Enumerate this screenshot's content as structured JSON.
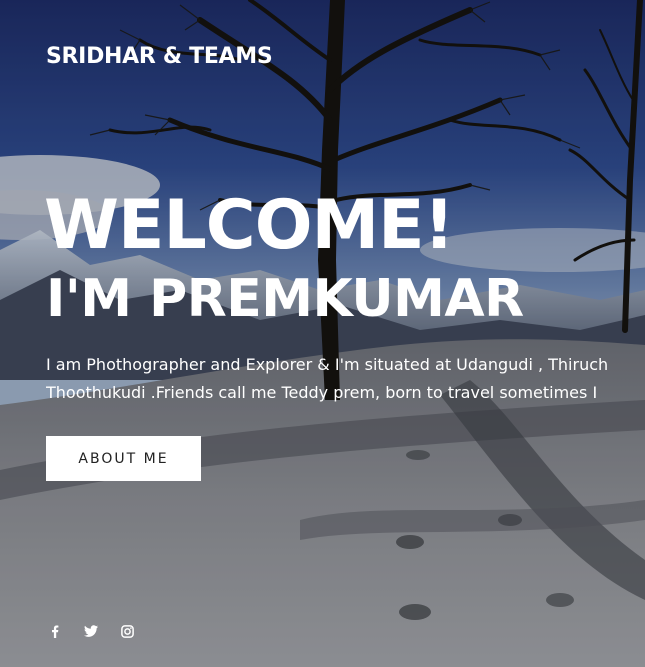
{
  "brand": {
    "name": "SRIDHAR & TEAMS"
  },
  "hero": {
    "heading_line1": "WELCOME!",
    "heading_line2": "I'M PREMKUMAR",
    "intro_line1": "I am Phothographer and Explorer & I'm situated at Udangudi , Thiruch",
    "intro_line2": "Thoothukudi .Friends call me Teddy prem, born to travel sometimes I",
    "button_label": "ABOUT ME"
  },
  "social": {
    "icons": [
      "facebook-icon",
      "twitter-icon",
      "instagram-icon"
    ]
  },
  "colors": {
    "text": "#ffffff",
    "button_bg": "#ffffff",
    "button_text": "#222222",
    "sky": "#2b3c78",
    "snow": "#8a8c92"
  }
}
